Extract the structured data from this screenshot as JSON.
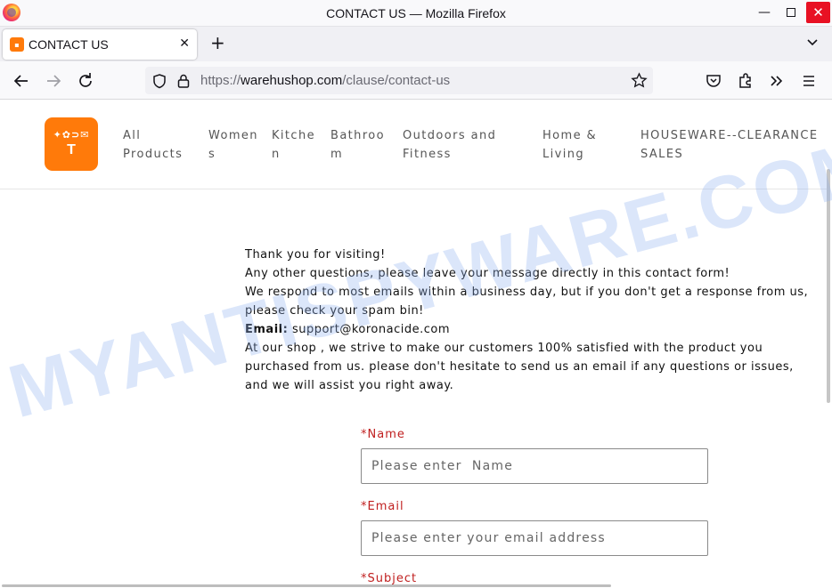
{
  "window": {
    "title": "CONTACT US — Mozilla Firefox",
    "minimize_glyph": "—",
    "close_glyph": "✕"
  },
  "tab": {
    "title": "CONTACT US",
    "close_glyph": "✕",
    "new_tab_glyph": "+"
  },
  "urlbar": {
    "scheme": "https://",
    "host": "warehushop.com",
    "path": "/clause/contact-us"
  },
  "site": {
    "logo_text": "T",
    "nav": [
      {
        "label": "All\nProducts"
      },
      {
        "label": "Women\ns"
      },
      {
        "label": "Kitche\nn"
      },
      {
        "label": "Bathroo\nm"
      },
      {
        "label": "Outdoors and\nFitness"
      },
      {
        "label": "Home &\nLiving"
      },
      {
        "label": "HOUSEWARE--CLEARANCE\nSALES"
      }
    ]
  },
  "intro": {
    "line1": "Thank you for visiting!",
    "line2": "Any other questions, please leave your message directly in this contact form!",
    "line3": "We respond to most emails within a business day, but if you don't get a response from us, please check your spam bin!",
    "email_label": "Email:",
    "email_value": " support@koronacide.com",
    "line5": "At our shop , we strive to make our customers 100% satisfied with the product you purchased from us. please don't hesitate to send us an email if any questions or issues, and we will assist you right away."
  },
  "form": {
    "name_label": "*Name",
    "name_placeholder": "Please enter  Name",
    "email_label": "*Email",
    "email_placeholder": "Please enter your email address",
    "subject_label": "*Subject"
  },
  "watermark": {
    "text": "MYANTISPYWARE.COM"
  },
  "colors": {
    "brand_orange": "#ff7a0a",
    "required_red": "#c02020",
    "close_red": "#e81123",
    "watermark_blue": "#8fb0ee"
  },
  "icons": [
    "firefox-logo-icon",
    "back-arrow-icon",
    "forward-arrow-icon",
    "reload-icon",
    "shield-icon",
    "lock-icon",
    "bookmark-star-icon",
    "pocket-icon",
    "extensions-icon",
    "overflow-chevrons-icon",
    "hamburger-menu-icon",
    "tab-list-chevron-icon"
  ]
}
